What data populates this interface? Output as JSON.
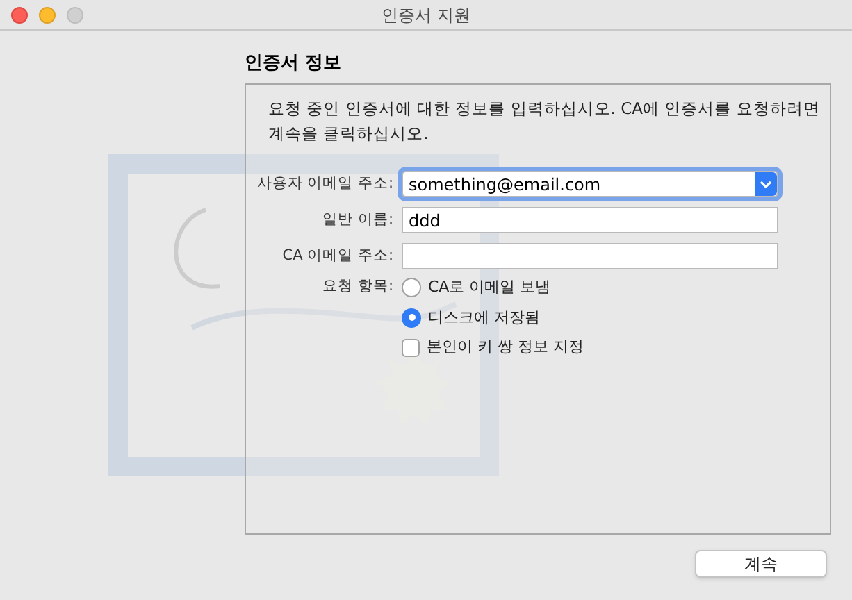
{
  "window": {
    "title": "인증서 지원"
  },
  "heading": "인증서 정보",
  "description": "요청 중인 인증서에 대한 정보를 입력하십시오. CA에 인증서를 요청하려면 계속을 클릭하십시오.",
  "fields": [
    {
      "label": "사용자 이메일 주소:",
      "value": "something@email.com",
      "kind": "popup",
      "focused": true
    },
    {
      "label": "일반 이름:",
      "value": "ddd",
      "kind": "text",
      "focused": false
    },
    {
      "label": "CA 이메일 주소:",
      "kind": "text",
      "focused": false
    }
  ],
  "request": {
    "label": "요청 항목:",
    "options": [
      {
        "label": "CA로 이메일 보냄",
        "kind": "radio",
        "selected": false
      },
      {
        "label": "디스크에 저장됨",
        "kind": "radio",
        "selected": true
      },
      {
        "label": "본인이 키 쌍 정보 지정",
        "kind": "checkbox",
        "checked": false
      }
    ]
  },
  "buttons": [
    "계속"
  ]
}
